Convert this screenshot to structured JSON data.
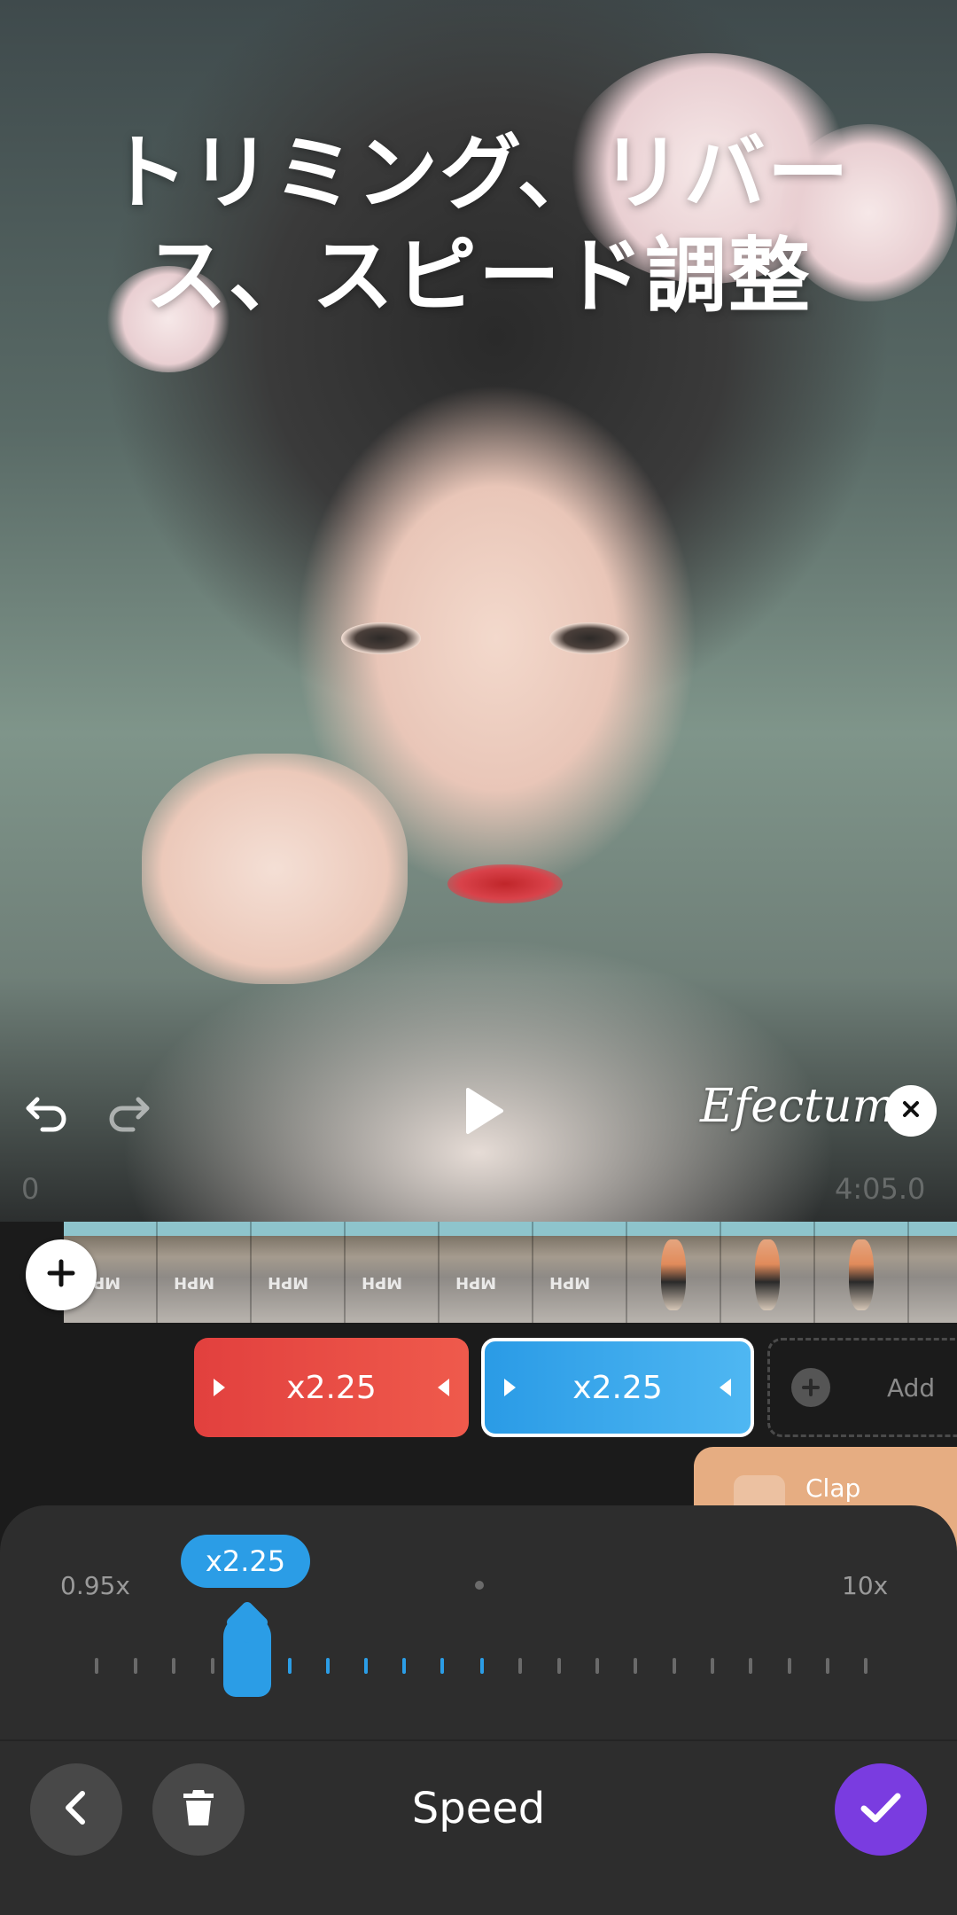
{
  "preview": {
    "headline_line1": "トリミング、リバー",
    "headline_line2": "ス、スピード調整",
    "brand": "Efectum",
    "time_start": "0",
    "time_end": "4:05.0"
  },
  "timeline": {
    "segments": [
      {
        "label": "x2.25",
        "color": "#e84a44"
      },
      {
        "label": "x2.25",
        "color": "#2b9de6",
        "selected": true
      }
    ],
    "add_segment_label": "Add",
    "clap_label": "Clap"
  },
  "speed_panel": {
    "current_value": "x2.25",
    "min_label": "0.95x",
    "max_label": "10x",
    "title": "Speed"
  },
  "colors": {
    "accent_blue": "#2b9de6",
    "accent_red": "#e84a44",
    "confirm_purple": "#7a3ce0"
  },
  "icons": [
    "undo-icon",
    "redo-icon",
    "play-icon",
    "close-icon",
    "plus-icon",
    "back-icon",
    "trash-icon",
    "check-icon"
  ]
}
